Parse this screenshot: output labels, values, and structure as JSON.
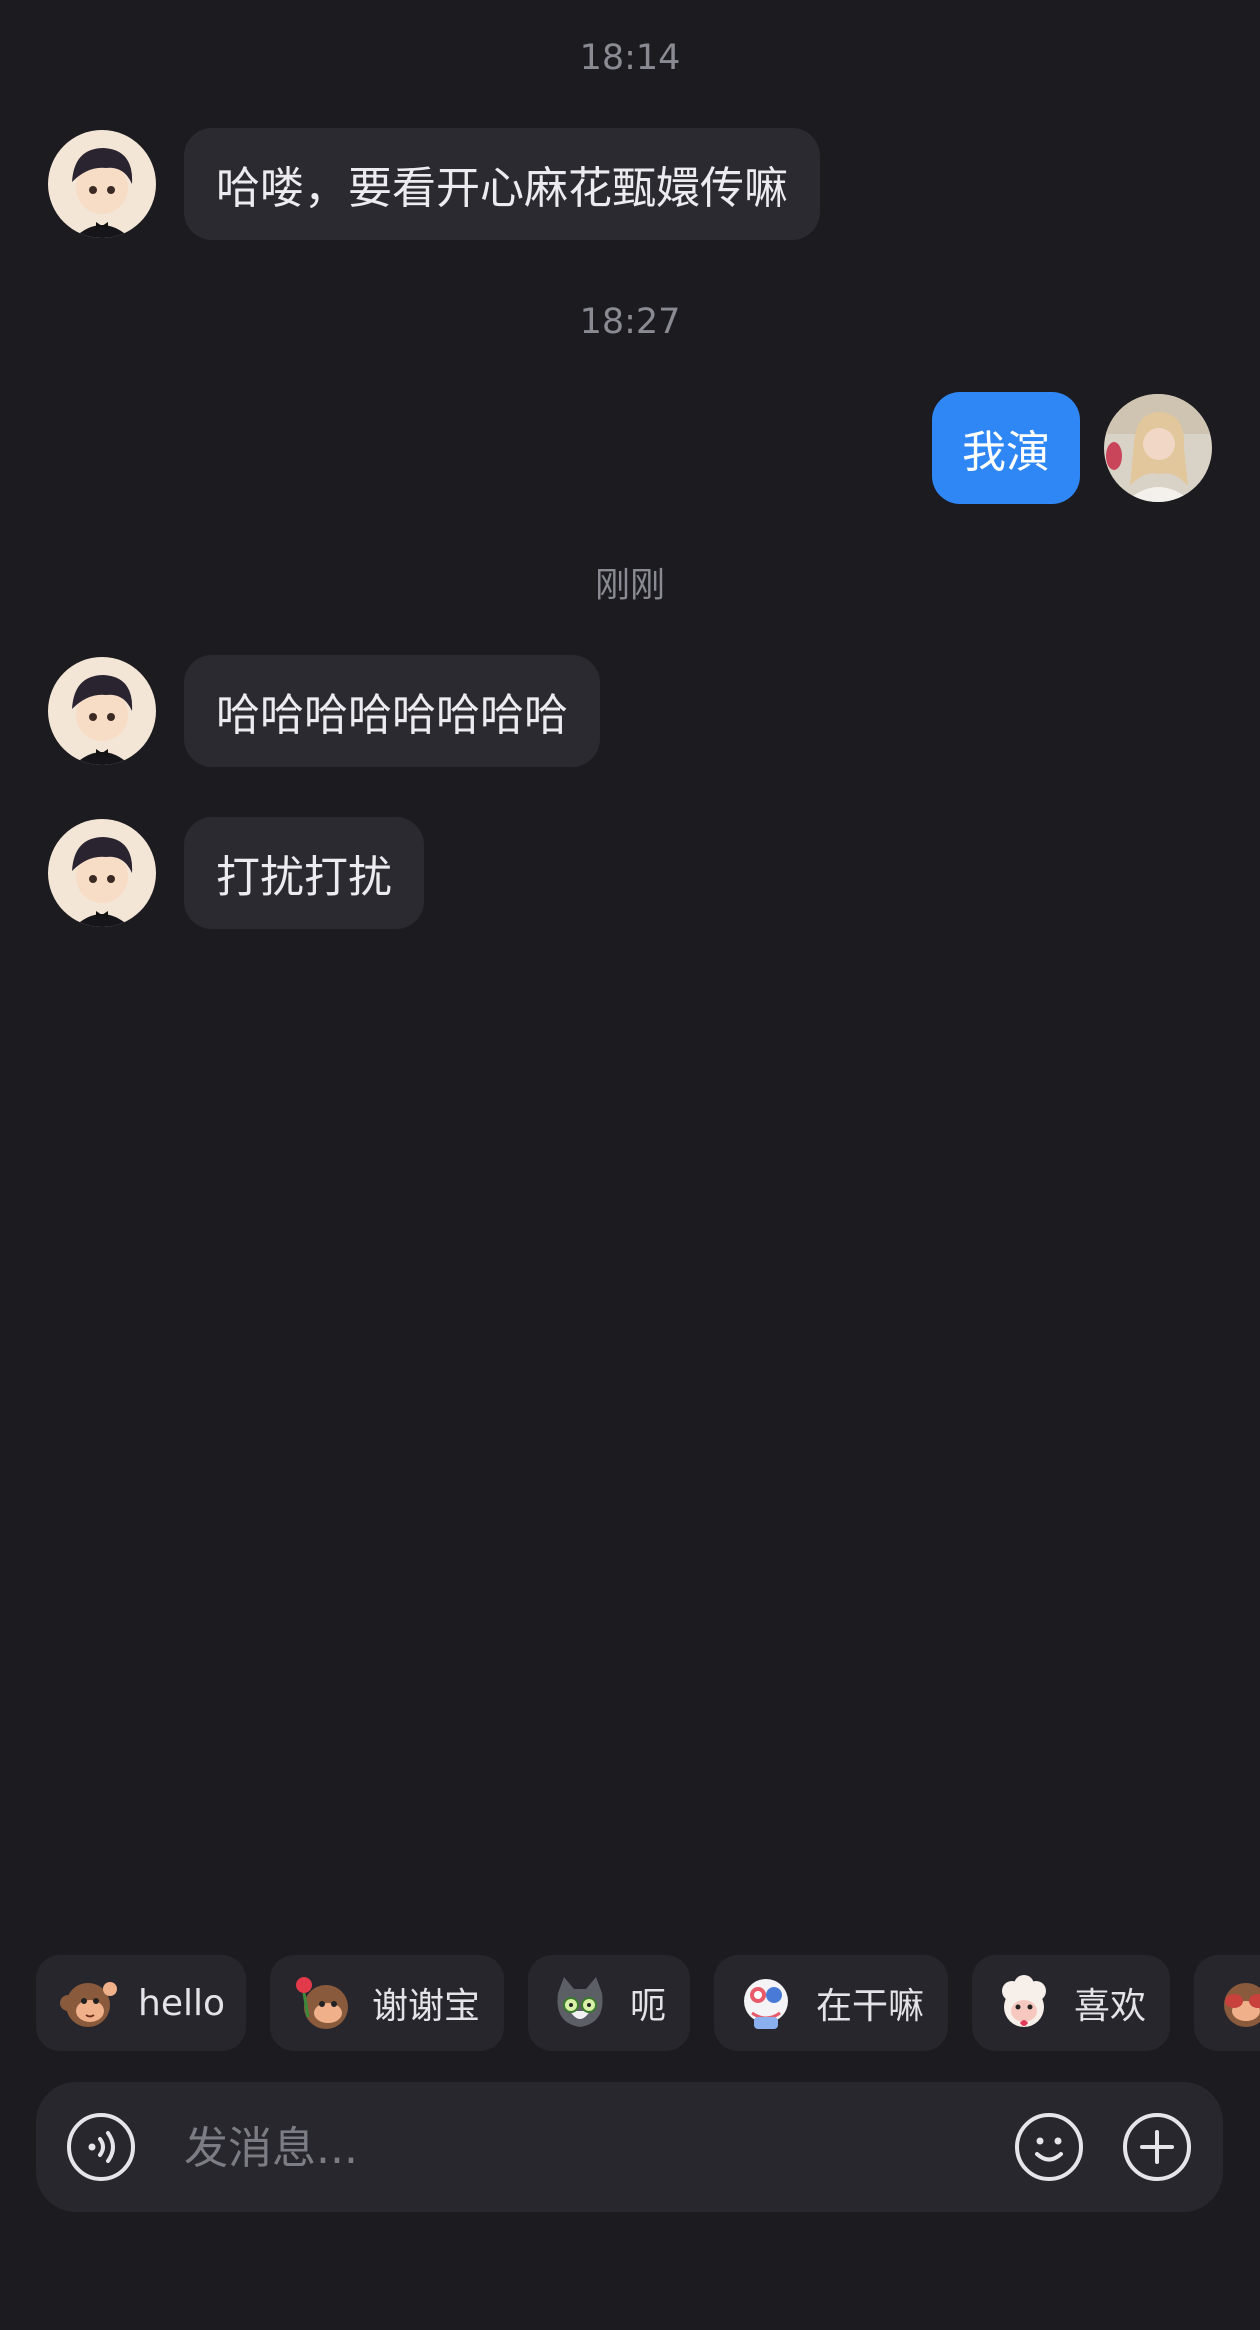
{
  "chat": {
    "timestamps": [
      "18:14",
      "18:27",
      "刚刚"
    ],
    "messages": [
      {
        "sender": "other",
        "text": "哈喽，要看开心麻花甄嬛传嘛"
      },
      {
        "sender": "self",
        "text": "我演"
      },
      {
        "sender": "other",
        "text": "哈哈哈哈哈哈哈哈"
      },
      {
        "sender": "other",
        "text": "打扰打扰"
      }
    ]
  },
  "quick_replies": [
    {
      "label": "hello",
      "icon": "monkey-wave-icon"
    },
    {
      "label": "谢谢宝",
      "icon": "monkey-rose-icon"
    },
    {
      "label": "呃",
      "icon": "cat-face-icon"
    },
    {
      "label": "在干嘛",
      "icon": "peeking-character-icon"
    },
    {
      "label": "喜欢",
      "icon": "sheep-heart-icon"
    },
    {
      "label": "",
      "icon": "monkey-shy-icon"
    }
  ],
  "input_bar": {
    "placeholder": "发消息...",
    "voice_icon": "voice-icon",
    "emoji_icon": "emoji-icon",
    "plus_icon": "plus-icon"
  },
  "colors": {
    "background": "#1b1b20",
    "bubble_other": "#2a2a30",
    "bubble_self": "#2f87f6",
    "timestamp": "#8a8a92"
  }
}
